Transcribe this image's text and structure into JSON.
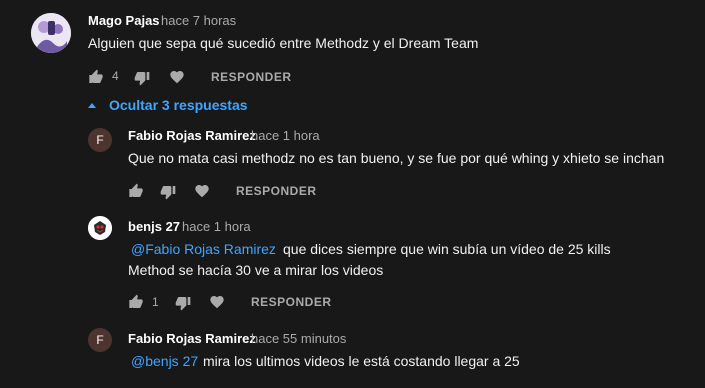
{
  "colors": {
    "background": "#181818",
    "text": "#f1f1f1",
    "muted": "#aaaaaa",
    "link": "#3ea6ff",
    "avatar_f": "#4e342e"
  },
  "comment": {
    "author": "Mago Pajas",
    "time": "hace 7 horas",
    "text": "Alguien que sepa qué sucedió entre Methodz y el Dream Team",
    "likes": "4",
    "reply_label": "RESPONDER"
  },
  "replies_toggle": {
    "label": "Ocultar 3 respuestas",
    "icon": "caret-up-icon"
  },
  "replies": [
    {
      "author": "Fabio Rojas Ramirez",
      "time": "hace 1 hora",
      "avatar_letter": "F",
      "text": "Que no mata casi methodz no es tan bueno, y se fue por qué whing y xhieto se inchan",
      "reply_label": "RESPONDER"
    },
    {
      "author": "benjs 27",
      "time": "hace 1 hora",
      "mention": "@Fabio Rojas Ramirez",
      "text_line1": "que dices siempre que win subía un vídeo de 25 kills",
      "text_line2": "Method se hacía 30 ve a mirar los videos",
      "likes": "1",
      "reply_label": "RESPONDER"
    },
    {
      "author": "Fabio Rojas Ramirez",
      "time": "hace 55 minutos",
      "avatar_letter": "F",
      "mention": "@benjs 27",
      "text": "mira los ultimos videos le está costando llegar a 25"
    }
  ]
}
